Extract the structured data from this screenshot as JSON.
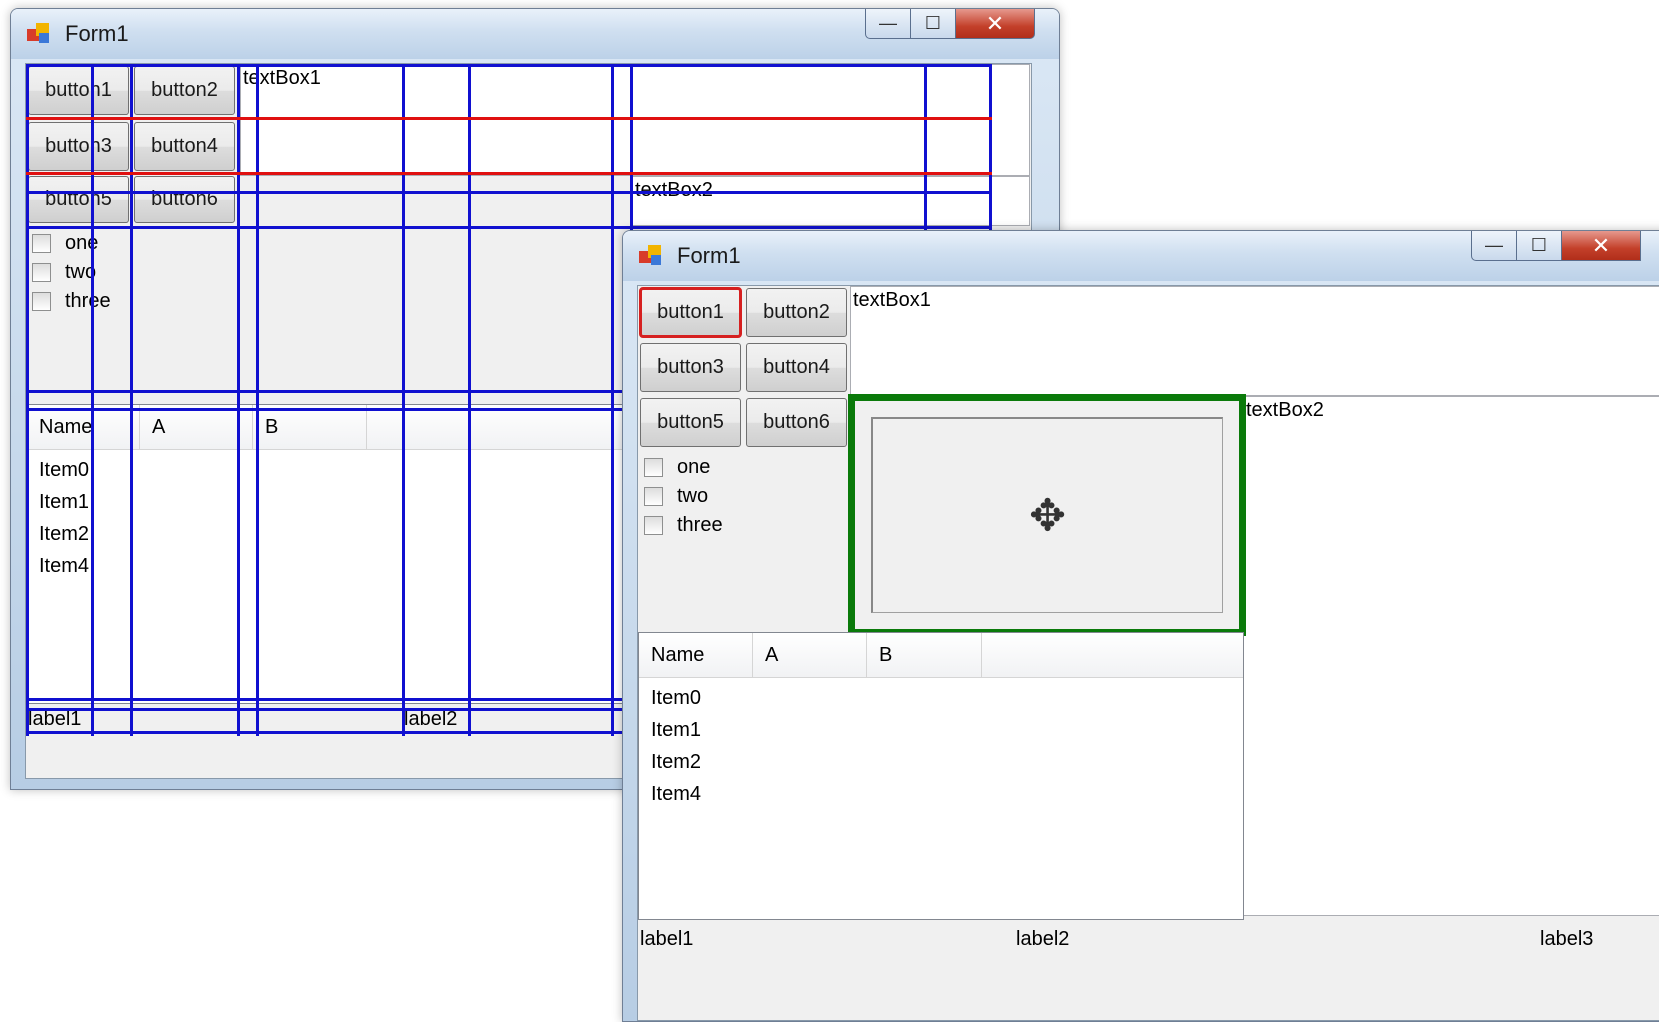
{
  "window1": {
    "title": "Form1",
    "controls": {
      "minimize": "—",
      "maximize": "☐",
      "close": "✕"
    },
    "buttons": [
      "button1",
      "button2",
      "button3",
      "button4",
      "button5",
      "button6"
    ],
    "textbox1": "textBox1",
    "textbox2": "textBox2",
    "checkboxes": [
      "one",
      "two",
      "three"
    ],
    "listview": {
      "columns": [
        "Name",
        "A",
        "B"
      ],
      "items": [
        "Item0",
        "Item1",
        "Item2",
        "Item4"
      ]
    },
    "labels": [
      "label1",
      "label2"
    ]
  },
  "window2": {
    "title": "Form1",
    "controls": {
      "minimize": "—",
      "maximize": "☐",
      "close": "✕"
    },
    "buttons": [
      "button1",
      "button2",
      "button3",
      "button4",
      "button5",
      "button6"
    ],
    "textbox1": "textBox1",
    "textbox2": "textBox2",
    "checkboxes": [
      "one",
      "two",
      "three"
    ],
    "listview": {
      "columns": [
        "Name",
        "A",
        "B"
      ],
      "items": [
        "Item0",
        "Item1",
        "Item2",
        "Item4"
      ]
    },
    "labels": [
      "label1",
      "label2",
      "label3"
    ],
    "move_icon": "move-cursor-icon",
    "colors": {
      "panel_border": "#0a7a0a",
      "focus_border": "#d62020"
    }
  },
  "grid_colors": {
    "column_lines": "#1010d0",
    "row_highlight": "#e01010"
  }
}
